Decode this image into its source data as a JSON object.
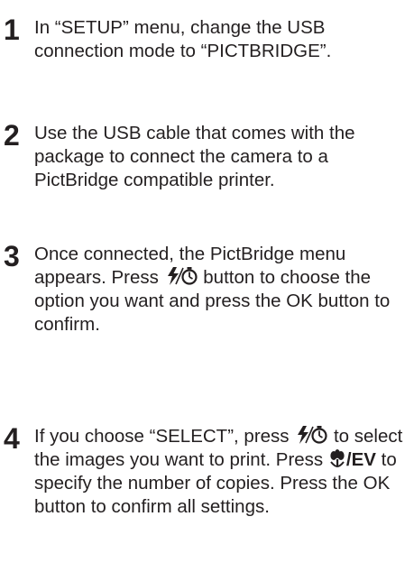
{
  "steps": [
    {
      "number": "1",
      "text": "In “SETUP” menu, change the USB connection mode to “PICTBRIDGE”."
    },
    {
      "number": "2",
      "text": "Use the USB cable that comes with the package to connect the camera to a PictBridge compatible printer."
    },
    {
      "number": "3",
      "text_before_icon": "Once connected, the PictBridge menu appears. Press ",
      "icon": "flash-self-timer-icon",
      "text_after_icon": " button to choose the option you want and press the OK button to confirm."
    },
    {
      "number": "4",
      "text_before_icon": "If you choose “SELECT”, press ",
      "icon": "flash-self-timer-icon",
      "text_middle": " to select the images you want to print. Press ",
      "icon2": "macro-icon",
      "bold_label": "/EV",
      "text_after_icon": " to specify the number of copies. Press the OK button to confirm all settings."
    }
  ]
}
